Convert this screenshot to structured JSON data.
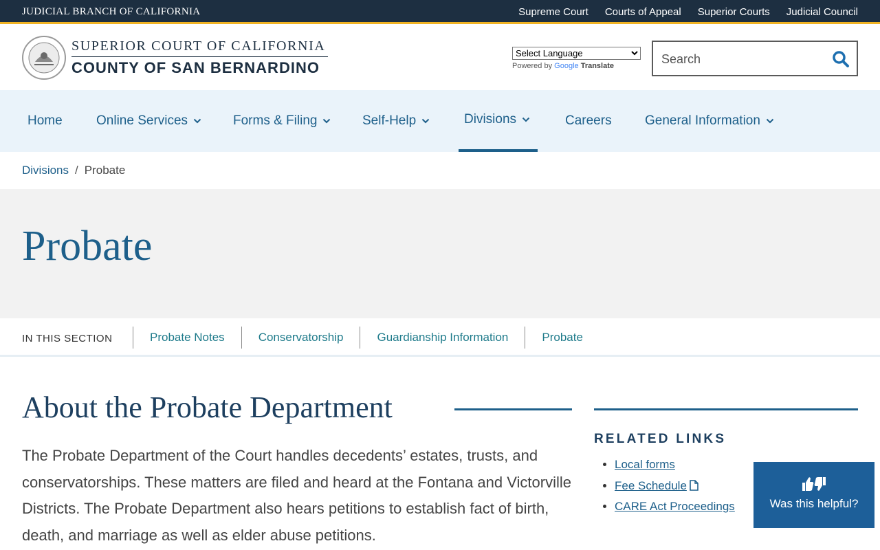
{
  "utility_bar": {
    "brand": "JUDICIAL BRANCH OF CALIFORNIA",
    "links": [
      "Supreme Court",
      "Courts of Appeal",
      "Superior Courts",
      "Judicial Council"
    ]
  },
  "header": {
    "court_line1": "SUPERIOR COURT OF CALIFORNIA",
    "court_line2": "COUNTY OF SAN BERNARDINO",
    "seal_text": "JUDICIAL BRANCH OF CALIFORNIA",
    "translate": {
      "select_value": "Select Language",
      "powered_by": "Powered by",
      "google": "Google",
      "translate_label": "Translate"
    },
    "search": {
      "placeholder": "Search",
      "value": ""
    }
  },
  "nav": {
    "items": [
      {
        "label": "Home"
      },
      {
        "label": "Online Services"
      },
      {
        "label": "Forms & Filing"
      },
      {
        "label": "Self-Help"
      },
      {
        "label": "Divisions"
      },
      {
        "label": "Careers"
      },
      {
        "label": "General Information"
      }
    ],
    "active": "Divisions"
  },
  "breadcrumb": {
    "parent": "Divisions",
    "separator": "/",
    "current": "Probate"
  },
  "hero": {
    "title": "Probate"
  },
  "section_nav": {
    "label": "IN THIS SECTION",
    "links": [
      "Probate Notes",
      "Conservatorship",
      "Guardianship Information",
      "Probate"
    ]
  },
  "content": {
    "title": "About the Probate Department",
    "body": "The Probate Department of the Court handles decedents’ estates, trusts, and conservatorships. These matters are filed and heard at the Fontana and Victorville Districts. The Probate Department also hears petitions to establish fact of birth, death, and marriage as well as elder abuse petitions."
  },
  "sidebar": {
    "heading": "RELATED LINKS",
    "links": [
      "Local forms",
      "Fee Schedule",
      "CARE Act Proceedings"
    ]
  },
  "feedback": {
    "label": "Was this helpful?"
  },
  "colors": {
    "utility_bg": "#1d2f41",
    "accent_gold": "#f0b323",
    "link_blue": "#1d5f8a",
    "nav_bg": "#eaf3fa",
    "hero_bg": "#f2f2f2",
    "feedback_bg": "#1d5f99"
  },
  "icons": {
    "search": "search-icon",
    "chevron": "chevron-down-icon",
    "document": "document-icon",
    "feedback": "thumbs-up-down-icon"
  }
}
